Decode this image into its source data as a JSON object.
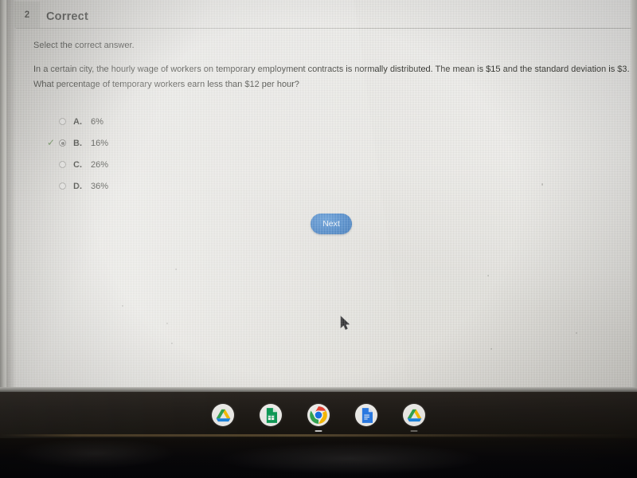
{
  "header": {
    "question_number": "2",
    "status": "Correct"
  },
  "instruction": "Select the correct answer.",
  "question": {
    "line1": "In a certain city, the hourly wage of workers on temporary employment contracts is normally distributed. The mean is $15 and the standard deviation is $3.",
    "line2": "What percentage of temporary workers earn less than $12 per hour?"
  },
  "options": [
    {
      "letter": "A.",
      "text": "6%",
      "selected": false,
      "correct": false
    },
    {
      "letter": "B.",
      "text": "16%",
      "selected": true,
      "correct": true
    },
    {
      "letter": "C.",
      "text": "26%",
      "selected": false,
      "correct": false
    },
    {
      "letter": "D.",
      "text": "36%",
      "selected": false,
      "correct": false
    }
  ],
  "correct_mark": "✓",
  "next_button": {
    "label": "Next",
    "color": "#3a7cc4"
  },
  "taskbar": {
    "items": [
      {
        "name": "google-drive",
        "label": "Drive",
        "active": false
      },
      {
        "name": "google-sheets",
        "label": "Sheets",
        "active": false
      },
      {
        "name": "google-chrome",
        "label": "Chrome",
        "active": true
      },
      {
        "name": "google-docs",
        "label": "Docs",
        "active": false
      },
      {
        "name": "google-drive-2",
        "label": "Drive",
        "active": true
      }
    ]
  },
  "colors": {
    "screen_background": "#e9e8e3",
    "text": "#24251f",
    "check_green": "#4f7a3a",
    "shelf": "#1d1915"
  }
}
